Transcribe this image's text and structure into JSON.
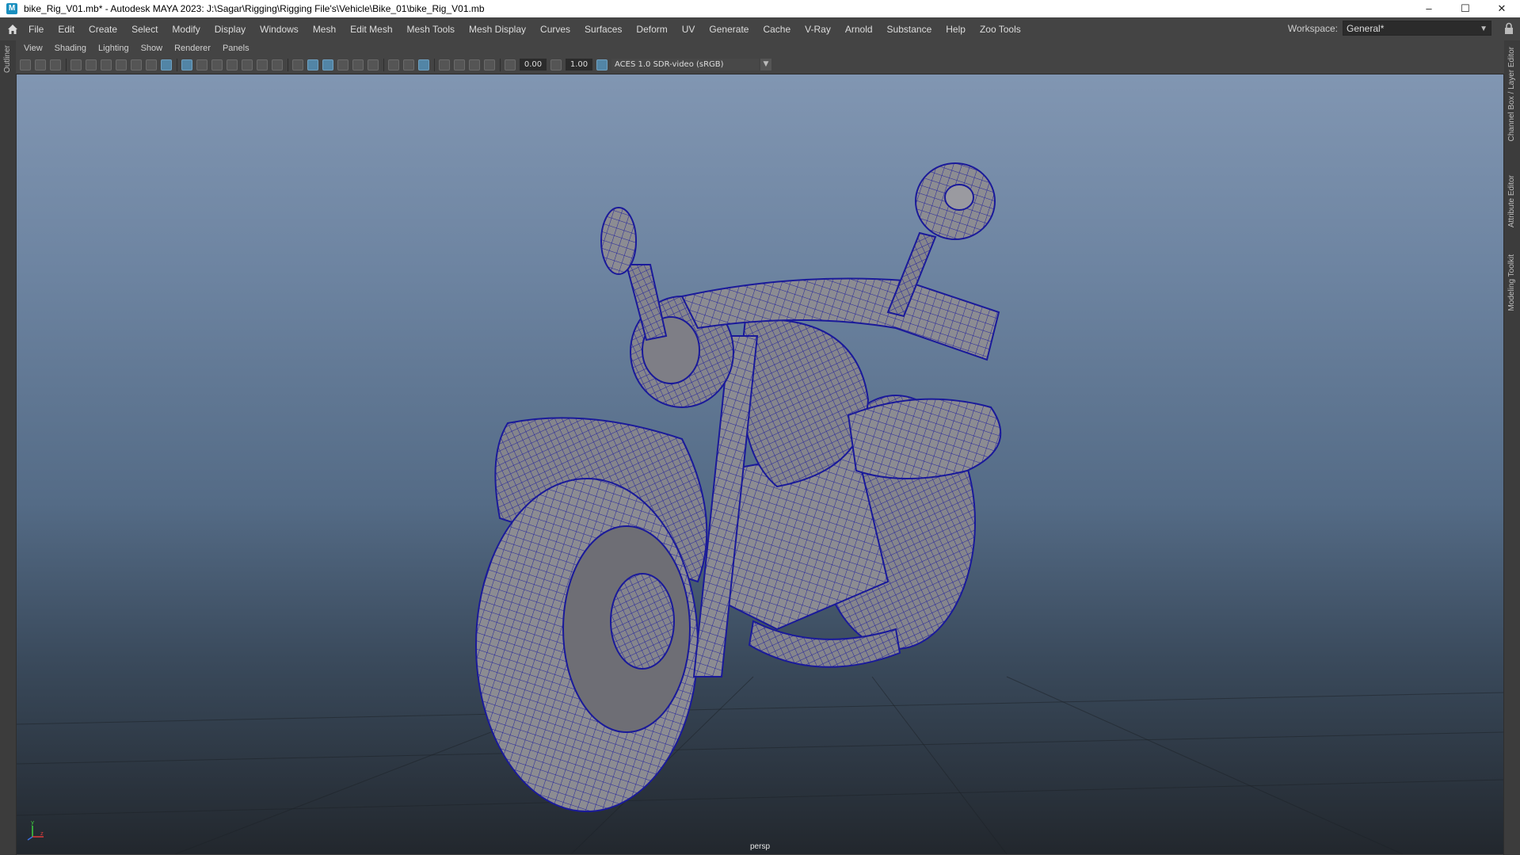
{
  "window": {
    "title": "bike_Rig_V01.mb* - Autodesk MAYA 2023: J:\\Sagar\\Rigging\\Rigging File's\\Vehicle\\Bike_01\\bike_Rig_V01.mb",
    "app_icon_letter": "M",
    "controls": [
      "–",
      "☐",
      "✕"
    ]
  },
  "menubar": {
    "items": [
      "File",
      "Edit",
      "Create",
      "Select",
      "Modify",
      "Display",
      "Windows",
      "Mesh",
      "Edit Mesh",
      "Mesh Tools",
      "Mesh Display",
      "Curves",
      "Surfaces",
      "Deform",
      "UV",
      "Generate",
      "Cache",
      "V-Ray",
      "Arnold",
      "Substance",
      "Help",
      "Zoo Tools"
    ],
    "workspace_label": "Workspace:",
    "workspace_value": "General*"
  },
  "side": {
    "left_tab": "Outliner",
    "right_tabs": [
      "Channel Box / Layer Editor",
      "Attribute Editor",
      "Modeling Toolkit"
    ]
  },
  "panel_menu": {
    "items": [
      "View",
      "Shading",
      "Lighting",
      "Show",
      "Renderer",
      "Panels"
    ]
  },
  "panel_toolbar": {
    "near_value": "0.00",
    "far_value": "1.00",
    "color_space": "ACES 1.0 SDR-video (sRGB)"
  },
  "viewport": {
    "camera_label": "persp",
    "axis_labels": {
      "y": "y",
      "z": "z"
    },
    "wire_color": "#1f1fa8",
    "mesh_color": "#8a8a8e"
  }
}
